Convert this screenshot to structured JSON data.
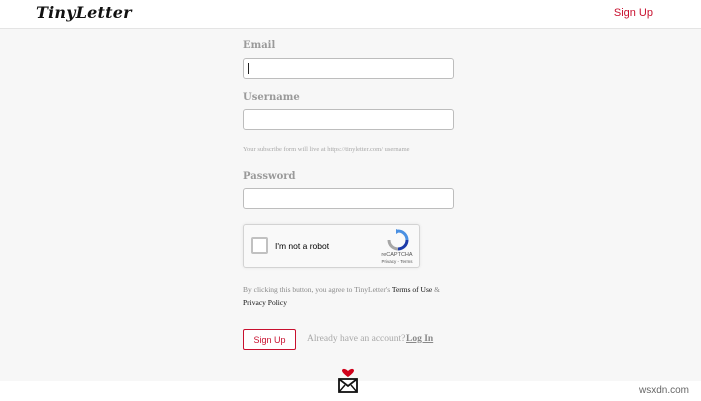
{
  "header": {
    "logo_text": "TinyLetter",
    "signup_link": "Sign Up"
  },
  "form": {
    "email": {
      "label": "Email",
      "value": ""
    },
    "username": {
      "label": "Username",
      "value": ""
    },
    "helper_text": "Your subscribe form will live at https://tinyletter.com/ username",
    "password": {
      "label": "Password",
      "value": ""
    },
    "captcha": {
      "checkbox_label": "I'm not a robot",
      "brand": "reCAPTCHA",
      "links": "Privacy - Terms"
    },
    "terms": {
      "prefix": "By clicking this button, you agree to TinyLetter's ",
      "terms_link": "Terms of Use",
      "amp": " &",
      "privacy_link": "Privacy Policy"
    },
    "submit_label": "Sign Up",
    "already_text": "Already have an account?",
    "login_link": "Log In"
  },
  "footer": {
    "icon": "envelope-heart-icon"
  },
  "watermark": "wsxdn.com",
  "colors": {
    "accent": "#c8102e",
    "background": "#f7f7f7"
  }
}
